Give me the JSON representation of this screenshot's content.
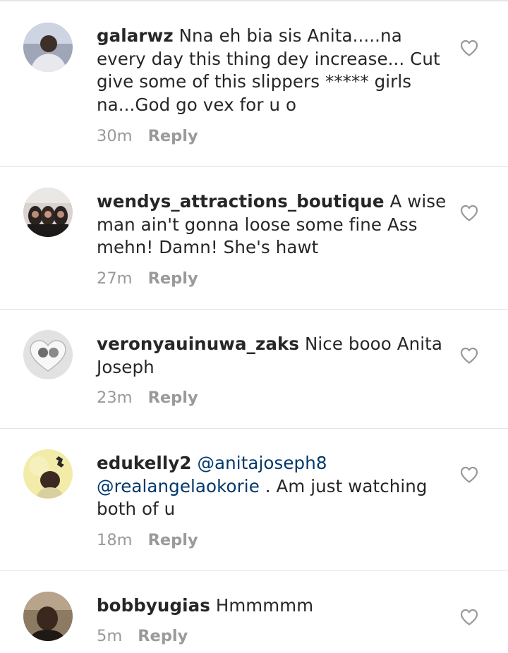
{
  "comments": [
    {
      "username": "galarwz",
      "text": "Nna eh bia  sis Anita.....na every day this thing dey increase... Cut give some of this slippers ***** girls na...God go vex for u o",
      "time": "30m",
      "reply": "Reply"
    },
    {
      "username": "wendys_attractions_boutique",
      "text": "A wise man ain't gonna loose some fine Ass mehn! Damn! She's hawt",
      "time": "27m",
      "reply": "Reply"
    },
    {
      "username": "veronyauinuwa_zaks",
      "text": "Nice booo Anita Joseph",
      "time": "23m",
      "reply": "Reply"
    },
    {
      "username": "edukelly2",
      "mention1": "@anitajoseph8",
      "mention2": "@realangelaokorie",
      "text": " . Am just watching both of u",
      "time": "18m",
      "reply": "Reply"
    },
    {
      "username": "bobbyugias",
      "text": "Hmmmmm",
      "time": "5m",
      "reply": "Reply"
    }
  ],
  "icons": {
    "like": "heart-outline-icon"
  },
  "colors": {
    "text": "#262626",
    "meta": "#999999",
    "mention": "#00376b",
    "divider": "#e3e3e3"
  }
}
